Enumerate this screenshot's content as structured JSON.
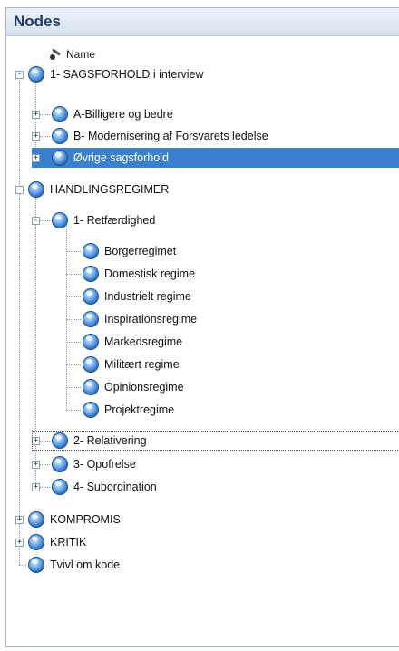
{
  "panel": {
    "title": "Nodes",
    "column_header": "Name"
  },
  "tree": [
    {
      "label": "1- SAGSFORHOLD i interview",
      "level": 0,
      "expander": "-",
      "icon": "node-icon"
    },
    {
      "label": "A-Billigere og bedre",
      "level": 1,
      "expander": "+",
      "icon": "node-icon"
    },
    {
      "label": "B- Modernisering af Forsvarets ledelse",
      "level": 1,
      "expander": "+",
      "icon": "node-icon"
    },
    {
      "label": "Øvrige sagsforhold",
      "level": 1,
      "expander": "+",
      "icon": "node-icon",
      "selected": true
    },
    {
      "label": "HANDLINGSREGIMER",
      "level": 0,
      "expander": "-",
      "icon": "node-icon"
    },
    {
      "label": "1- Retfærdighed",
      "level": 1,
      "expander": "-",
      "icon": "node-icon"
    },
    {
      "label": "Borgerregimet",
      "level": 2,
      "expander": "",
      "icon": "node-icon"
    },
    {
      "label": "Domestisk regime",
      "level": 2,
      "expander": "",
      "icon": "node-icon"
    },
    {
      "label": "Industrielt regime",
      "level": 2,
      "expander": "",
      "icon": "node-icon"
    },
    {
      "label": "Inspirationsregime",
      "level": 2,
      "expander": "",
      "icon": "node-icon"
    },
    {
      "label": "Markedsregime",
      "level": 2,
      "expander": "",
      "icon": "node-icon"
    },
    {
      "label": "Militært regime",
      "level": 2,
      "expander": "",
      "icon": "node-icon"
    },
    {
      "label": "Opinionsregime",
      "level": 2,
      "expander": "",
      "icon": "node-icon"
    },
    {
      "label": "Projektregime",
      "level": 2,
      "expander": "",
      "icon": "node-icon"
    },
    {
      "label": "2- Relativering",
      "level": 1,
      "expander": "+",
      "icon": "node-icon",
      "focused": true
    },
    {
      "label": "3- Opofrelse",
      "level": 1,
      "expander": "+",
      "icon": "node-icon"
    },
    {
      "label": "4- Subordination",
      "level": 1,
      "expander": "+",
      "icon": "node-icon"
    },
    {
      "label": "KOMPROMIS",
      "level": 0,
      "expander": "+",
      "icon": "node-icon"
    },
    {
      "label": "KRITIK",
      "level": 0,
      "expander": "+",
      "icon": "node-icon"
    },
    {
      "label": "Tvivl om kode",
      "level": 0,
      "expander": "",
      "icon": "node-icon"
    }
  ],
  "colors": {
    "selection": "#3b7fcf",
    "title": "#1f3b68"
  }
}
